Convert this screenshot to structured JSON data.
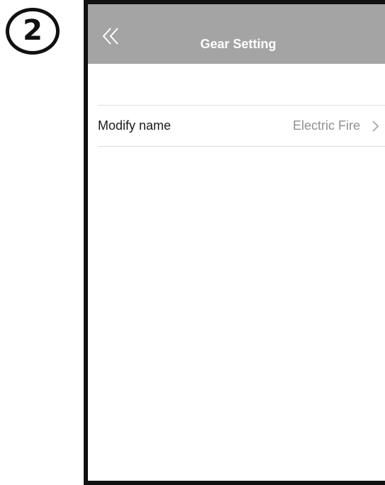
{
  "step_badge": "2",
  "header": {
    "title": "Gear Setting",
    "back_icon": "double-chevron-left-icon"
  },
  "settings": [
    {
      "label": "Modify name",
      "value": "Electric Fire",
      "icon": "chevron-right-icon"
    }
  ],
  "colors": {
    "header_bg": "#a4a4a4",
    "header_text": "#ffffff",
    "value_text": "#8f8f8f"
  }
}
